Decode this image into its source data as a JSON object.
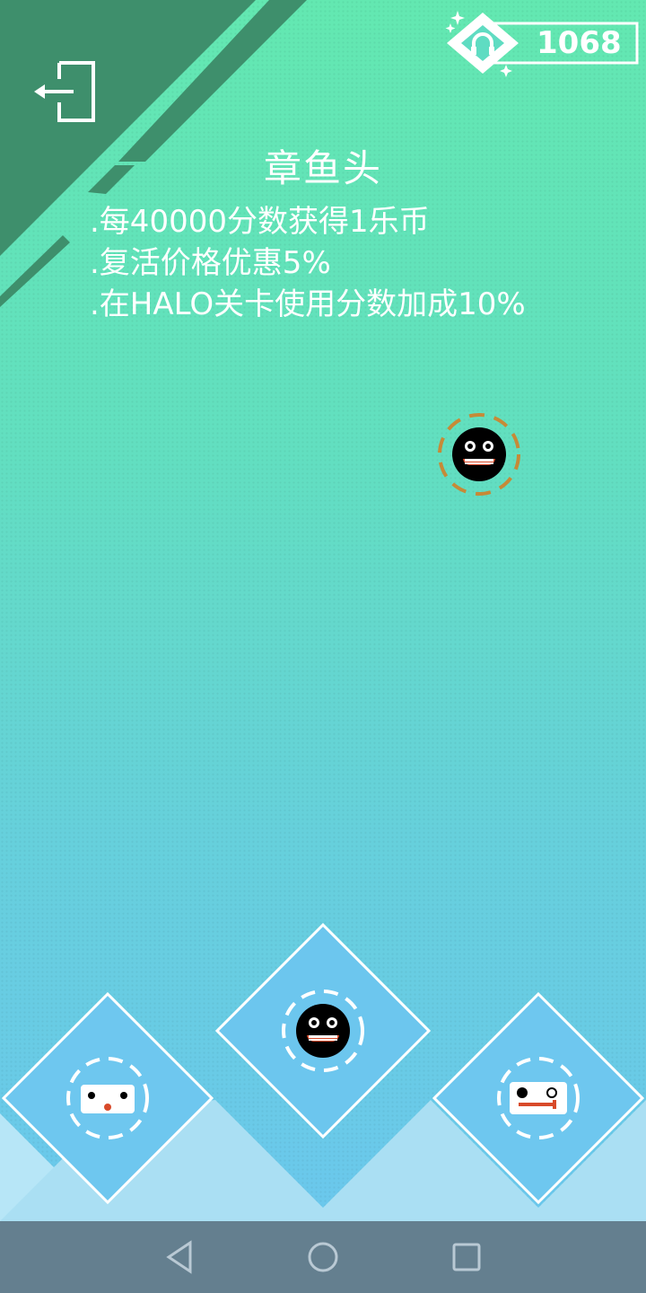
{
  "header": {
    "exit_icon": "exit-door-icon",
    "coin_icon": "headphones-diamond-icon",
    "coins": "1068"
  },
  "character": {
    "name": "章鱼头",
    "perks": [
      ".每40000分数获得1乐币",
      ".复活价格优惠5%",
      ".在HALO关卡使用分数加成10%"
    ]
  },
  "selector": {
    "items": [
      "white-block-face",
      "black-octopus-face",
      "white-robot-face"
    ],
    "selected": "black-octopus-face"
  },
  "navbar": {
    "icons": [
      "back-triangle-icon",
      "home-circle-icon",
      "recents-square-icon"
    ]
  },
  "colors": {
    "bg_top": "#63e8b1",
    "bg_bottom": "#6cc6f0",
    "corner_stripe": "#3e8f6c",
    "ring_orange": "#c68a37",
    "navbar": "#647f8f"
  }
}
